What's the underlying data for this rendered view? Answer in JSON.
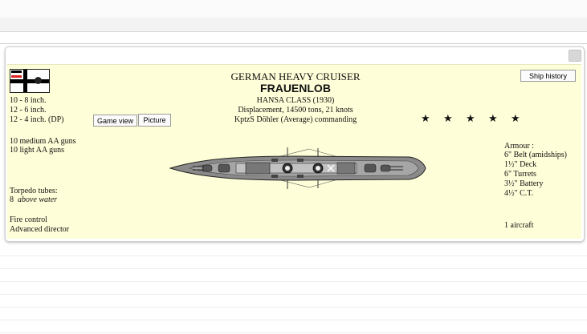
{
  "ship": {
    "type_title": "GERMAN HEAVY CRUISER",
    "name": "FRAUENLOB",
    "class_line": "HANSA CLASS (1930)",
    "displacement_line": "Displacement, 14500 tons, 21 knots",
    "commander_line": "KptzS Döhler (Average)  commanding"
  },
  "armament": {
    "main": [
      "10 - 8 inch.",
      "12 - 6 inch.",
      "12 - 4 inch. (DP)"
    ],
    "aa": [
      "10 medium AA guns",
      "10 light AA guns"
    ],
    "torpedo_title": "Torpedo tubes:",
    "torpedo_count": "8",
    "torpedo_location": "above water",
    "fire_control_title": "Fire control",
    "fire_control_value": "Advanced director"
  },
  "armour": {
    "title": "Armour :",
    "items": [
      "6\" Belt (amidships)",
      "1½\" Deck",
      "6\" Turrets",
      "3½\" Battery",
      "4½\" C.T."
    ]
  },
  "aircraft": "1 aircraft",
  "rating": {
    "stars": 5,
    "glyph": "★"
  },
  "buttons": {
    "ship_history": "Ship history",
    "game_view": "Game view",
    "picture": "Picture"
  },
  "icons": {
    "flag": "german-naval-ensign-icon",
    "ship": "ship-profile-icon",
    "close": "close-icon"
  },
  "colors": {
    "panel": "#fefed8",
    "window": "#ffffff",
    "ship_hull": "#8a8a8a"
  }
}
